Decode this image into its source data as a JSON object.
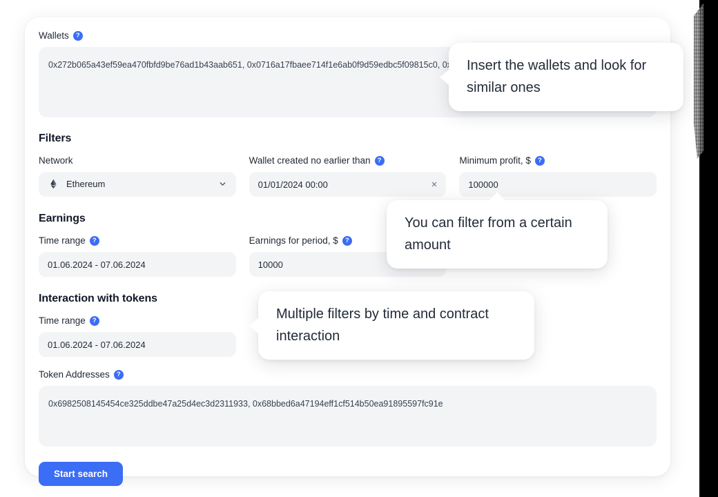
{
  "form": {
    "wallets": {
      "label": "Wallets",
      "help": "?",
      "value": "0x272b065a43ef59ea470fbfd9be76ad1b43aab651, 0x0716a17fbaee714f1e6ab0f9d59edbc5f09815c0, 0xcb8efb0c065071e4110932858a84365a80c8fef0"
    },
    "filters": {
      "title": "Filters",
      "network": {
        "label": "Network",
        "value": "Ethereum",
        "icon": "ethereum-logo",
        "chevron": "chevron-down-icon"
      },
      "wallet_created": {
        "label": "Wallet created no earlier than",
        "help": "?",
        "value": "01/01/2024 00:00",
        "clear": "×"
      },
      "minimum_profit": {
        "label": "Minimum profit, $",
        "help": "?",
        "value": "100000"
      }
    },
    "earnings": {
      "title": "Earnings",
      "time_range": {
        "label": "Time range",
        "help": "?",
        "value": "01.06.2024 - 07.06.2024"
      },
      "earnings_for_period": {
        "label": "Earnings for period, $",
        "help": "?",
        "value": "10000"
      }
    },
    "interaction": {
      "title": "Interaction with tokens",
      "time_range": {
        "label": "Time range",
        "help": "?",
        "value": "01.06.2024 - 07.06.2024"
      },
      "token_addresses": {
        "label": "Token Addresses",
        "help": "?",
        "value": "0x6982508145454ce325ddbe47a25d4ec3d2311933, 0x68bbed6a47194eff1cf514b50ea91895597fc91e"
      }
    },
    "submit": {
      "label": "Start search"
    }
  },
  "tooltips": {
    "wallets": "Insert the wallets and look for similar ones",
    "amount": "You can filter from a certain amount",
    "filters": "Multiple filters by time and contract interaction"
  },
  "colors": {
    "accent": "#3b6df5",
    "field_bg": "#f3f4f6",
    "text": "#1f2733"
  }
}
